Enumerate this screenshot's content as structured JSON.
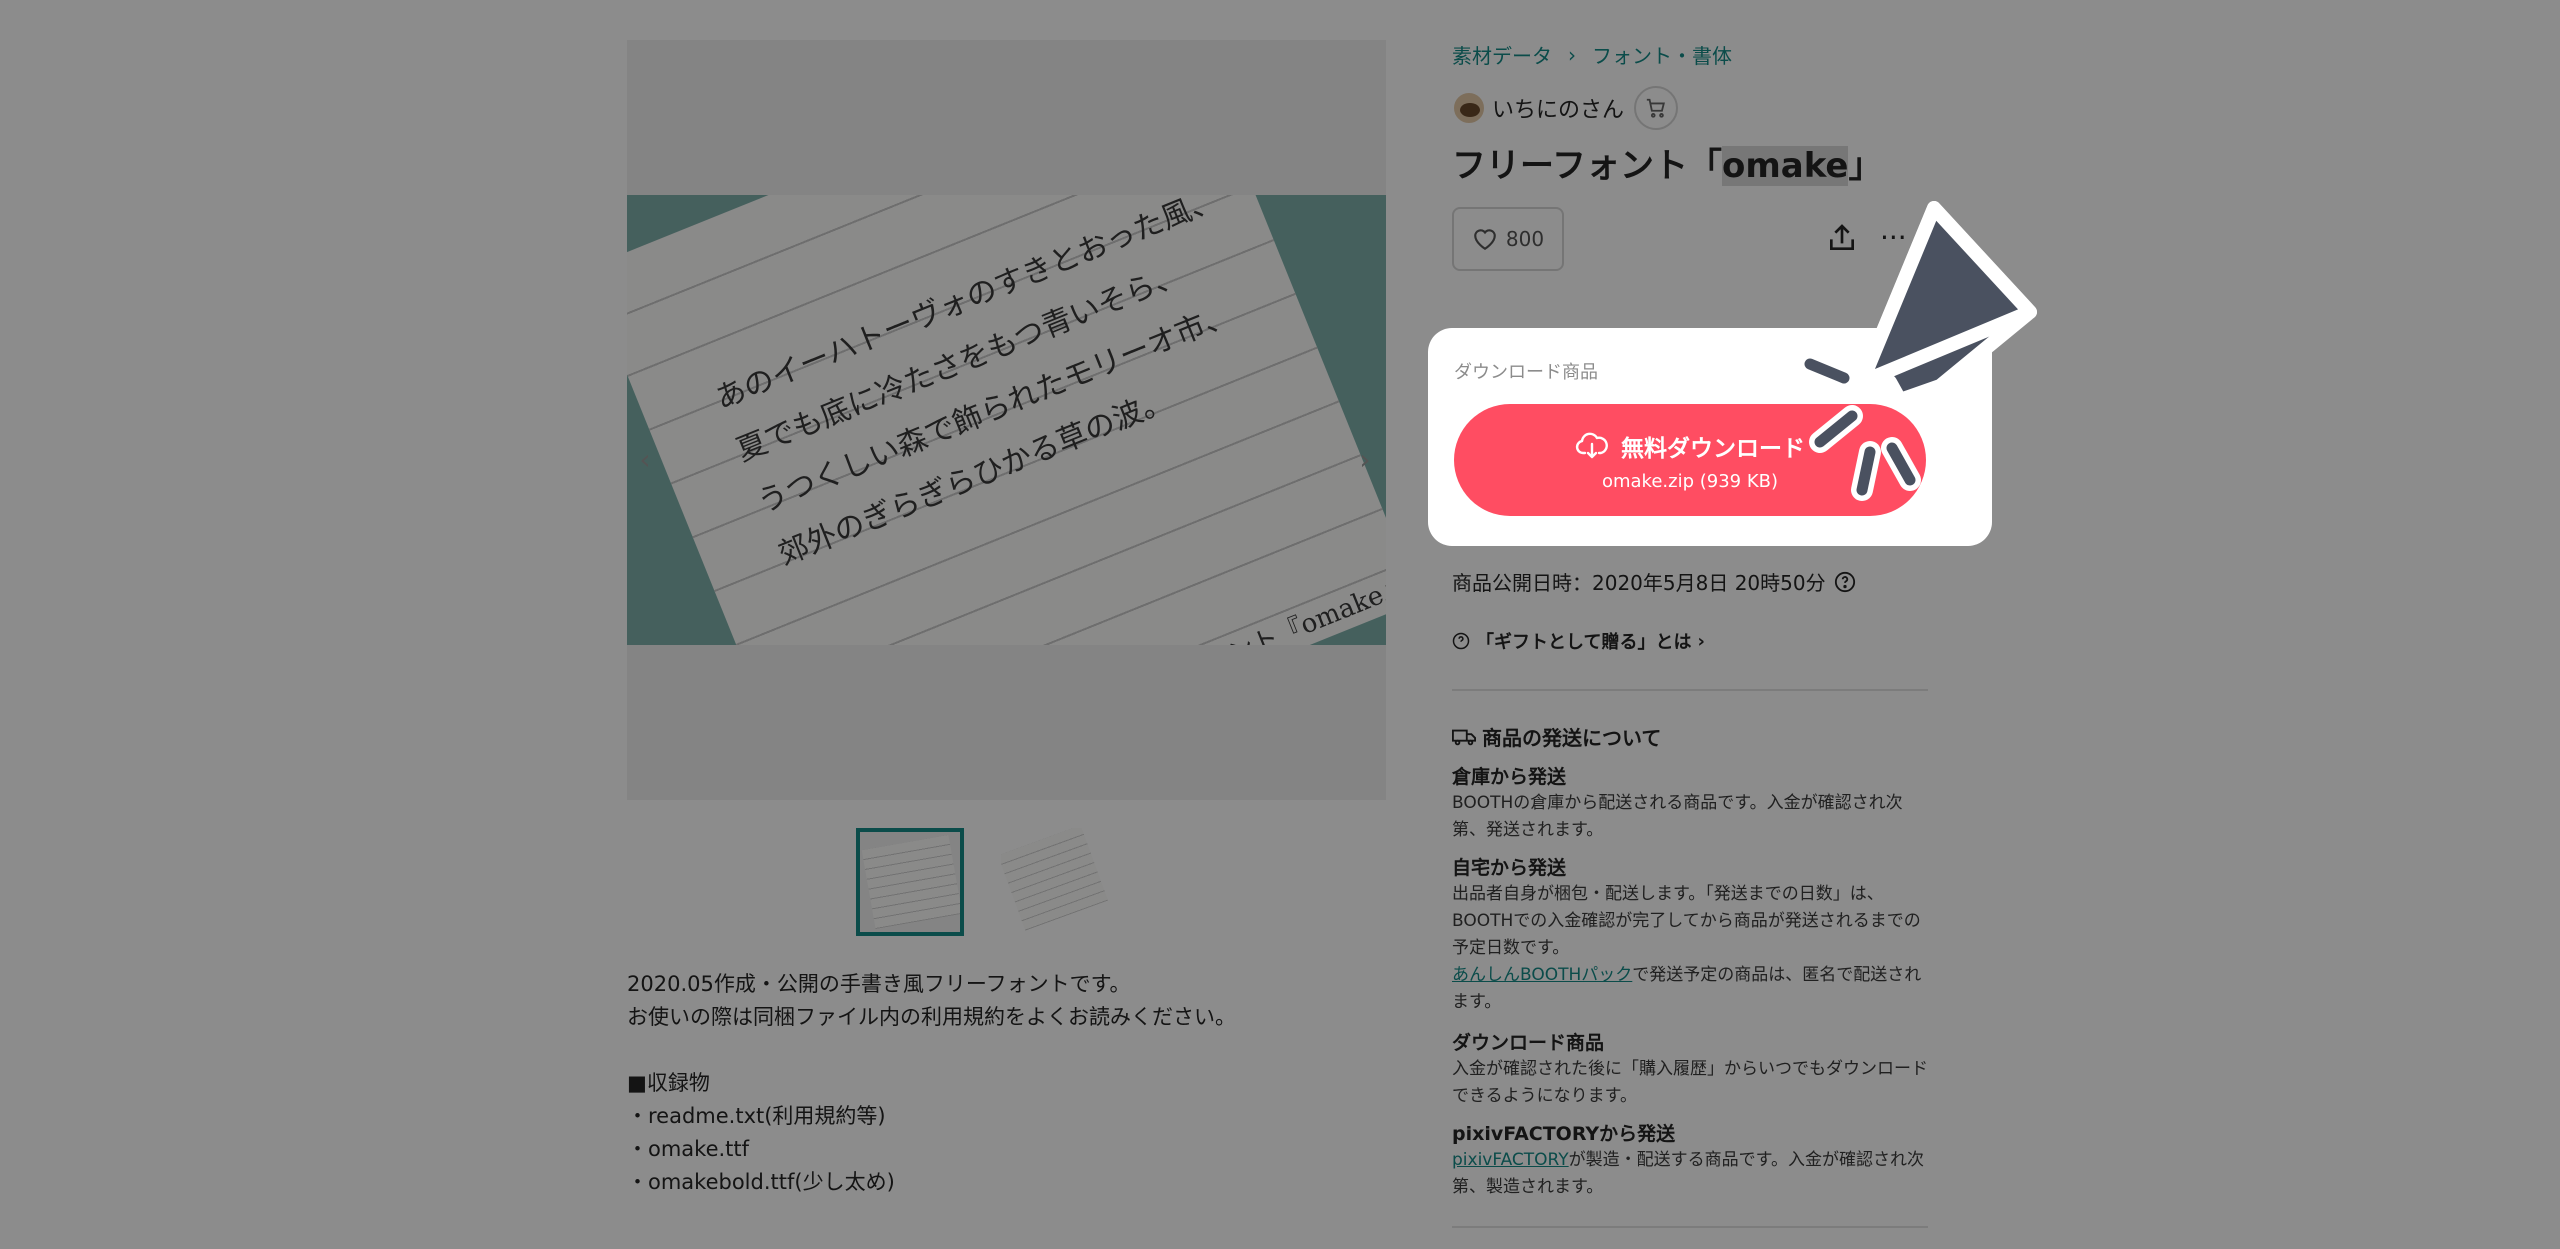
{
  "breadcrumb": [
    "素材データ",
    "フォント・書体"
  ],
  "shop": {
    "name": "いちにのさん"
  },
  "product": {
    "title_prefix": "フリーフォント「",
    "title_highlight": "omake",
    "title_suffix": "」"
  },
  "likes": {
    "count": "800"
  },
  "download": {
    "section_label": "ダウンロード商品",
    "button_label": "無料ダウンロード",
    "file": "omake.zip (939 KB)"
  },
  "info": {
    "published": "商品公開日時：2020年5月8日 20時50分",
    "gift_link": "「ギフトとして贈る」とは"
  },
  "shipping": {
    "heading": "商品の発送について",
    "warehouse": {
      "title": "倉庫から発送",
      "text": "BOOTHの倉庫から配送される商品です。入金が確認され次第、発送されます。"
    },
    "home": {
      "title": "自宅から発送",
      "text": "出品者自身が梱包・配送します。「発送までの日数」は、BOOTHでの入金確認が完了してから商品が発送されるまでの予定日数です。",
      "link": "あんしんBOOTHパック",
      "link_suffix": "で発送予定の商品は、匿名で配送されます。"
    },
    "download": {
      "title": "ダウンロード商品",
      "text": "入金が確認された後に「購入履歴」からいつでもダウンロードできるようになります。"
    },
    "factory": {
      "title": "pixivFACTORYから発送",
      "link": "pixivFACTORY",
      "text": "が製造・配送する商品です。入金が確認され次第、製造されます。"
    }
  },
  "image": {
    "lines": [
      "あのイーハトーヴォのすきとおった風、",
      "夏でも底に冷たさをもつ青いそら、",
      "うつくしい森で飾られたモリーオ市、",
      "郊外のぎらぎらひかる草の波。"
    ],
    "signature": "手書き風フォント『omake』"
  },
  "description": {
    "lines": [
      "2020.05作成・公開の手書き風フリーフォントです。",
      "お使いの際は同梱ファイル内の利用規約をよくお読みください。"
    ],
    "list_heading": "■収録物",
    "list": [
      "・readme.txt(利用規約等)",
      "・omake.ttf",
      "・omakebold.ttf(少し太め)"
    ]
  },
  "colors": {
    "accent": "#ff4d62",
    "link": "#158a87",
    "cursor": "#4a5160"
  }
}
